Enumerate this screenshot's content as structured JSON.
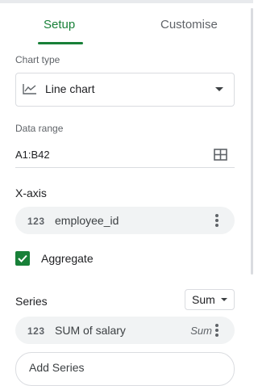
{
  "tabs": {
    "setup": "Setup",
    "customise": "Customise"
  },
  "chart_type": {
    "label": "Chart type",
    "value": "Line chart",
    "icon": "line-chart-icon"
  },
  "data_range": {
    "label": "Data range",
    "value": "A1:B42",
    "icon": "grid-select-icon"
  },
  "x_axis": {
    "title": "X-axis",
    "chip_type": "123",
    "chip_label": "employee_id"
  },
  "aggregate": {
    "label": "Aggregate",
    "checked": true
  },
  "series": {
    "title": "Series",
    "aggregate_select": "Sum",
    "chip_type": "123",
    "chip_label": "SUM of salary",
    "chip_agg": "Sum",
    "add_button": "Add Series"
  },
  "colors": {
    "accent": "#188038",
    "chip_bg": "#f1f3f4",
    "border": "#dadce0"
  }
}
